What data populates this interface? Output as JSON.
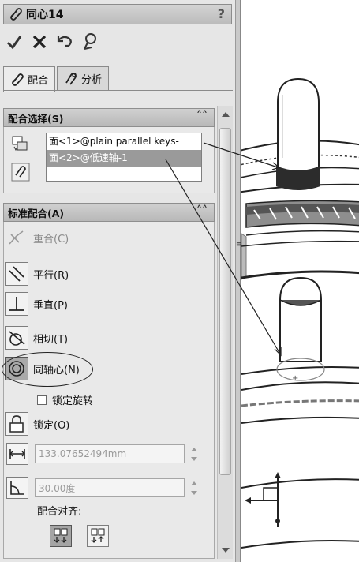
{
  "window": {
    "title": "同心14",
    "help": "?"
  },
  "actions": [
    {
      "name": "ok-icon"
    },
    {
      "name": "cancel-icon"
    },
    {
      "name": "undo-icon"
    },
    {
      "name": "pin-icon"
    }
  ],
  "tabs": [
    {
      "label": "配合",
      "icon": "paperclip-icon",
      "active": true
    },
    {
      "label": "分析",
      "icon": "analysis-icon",
      "active": false
    }
  ],
  "mate_selection": {
    "title": "配合选择(S)",
    "items": [
      "面<1>@plain parallel keys-",
      "面<2>@低速轴-1"
    ]
  },
  "standard_mates": {
    "title": "标准配合(A)",
    "mates": [
      {
        "label": "重合(C)",
        "icon": "coincident-icon",
        "state": "disabled"
      },
      {
        "label": "平行(R)",
        "icon": "parallel-icon",
        "state": "normal"
      },
      {
        "label": "垂直(P)",
        "icon": "perpendicular-icon",
        "state": "normal"
      },
      {
        "label": "相切(T)",
        "icon": "tangent-icon",
        "state": "normal"
      },
      {
        "label": "同轴心(N)",
        "icon": "concentric-icon",
        "state": "selected"
      }
    ],
    "lock_rotation_label": "锁定旋转",
    "lock": {
      "label": "锁定(O)"
    },
    "distance_value": "133.07652494mm",
    "angle_value": "30.00度",
    "alignment_label": "配合对齐:"
  },
  "colors": {
    "panel_bg": "#e6e6e6",
    "header_bg": "#c4c4c4",
    "selected_item": "#9a9a9a"
  }
}
